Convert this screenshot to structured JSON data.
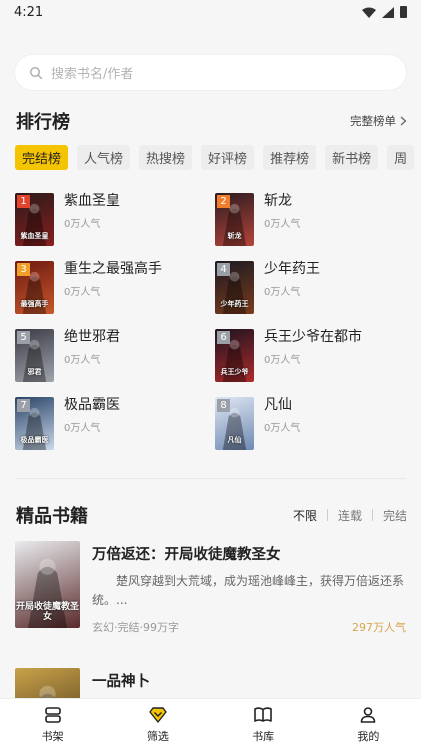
{
  "status": {
    "time": "4:21"
  },
  "search": {
    "placeholder": "搜索书名/作者"
  },
  "ranking": {
    "title": "排行榜",
    "more_label": "完整榜单",
    "tabs": [
      "完结榜",
      "人气榜",
      "热搜榜",
      "好评榜",
      "推荐榜",
      "新书榜",
      "周"
    ],
    "active_tab": 0,
    "items": [
      {
        "rank": "1",
        "title": "紫血圣皇",
        "hot": "0万人气",
        "badge_color": "#e3422c",
        "cover": [
          "#2a1a1a",
          "#8a1f1f"
        ],
        "cover_text": "紫血圣皇"
      },
      {
        "rank": "2",
        "title": "斩龙",
        "hot": "0万人气",
        "badge_color": "#ef7d2b",
        "cover": [
          "#2b1b20",
          "#b5453a"
        ],
        "cover_text": "斩龙"
      },
      {
        "rank": "3",
        "title": "重生之最强高手",
        "hot": "0万人气",
        "badge_color": "#f0a028",
        "cover": [
          "#6e1a12",
          "#c8572b"
        ],
        "cover_text": "最强高手"
      },
      {
        "rank": "4",
        "title": "少年药王",
        "hot": "0万人气",
        "badge_color": "#9ba0a8",
        "cover": [
          "#1a1a22",
          "#7c3b1c"
        ],
        "cover_text": "少年药王"
      },
      {
        "rank": "5",
        "title": "绝世邪君",
        "hot": "0万人气",
        "badge_color": "#9ba0a8",
        "cover": [
          "#3a3a44",
          "#a0a5ad"
        ],
        "cover_text": "邪君"
      },
      {
        "rank": "6",
        "title": "兵王少爷在都市",
        "hot": "0万人气",
        "badge_color": "#9ba0a8",
        "cover": [
          "#1c1420",
          "#b02a2a"
        ],
        "cover_text": "兵王少爷"
      },
      {
        "rank": "7",
        "title": "极品霸医",
        "hot": "0万人气",
        "badge_color": "#9ba0a8",
        "cover": [
          "#2a4466",
          "#c9d7ea"
        ],
        "cover_text": "极品霸医"
      },
      {
        "rank": "8",
        "title": "凡仙",
        "hot": "0万人气",
        "badge_color": "#9ba0a8",
        "cover": [
          "#dfe6f2",
          "#6f8ab4"
        ],
        "cover_text": "凡仙"
      }
    ]
  },
  "featured": {
    "title": "精品书籍",
    "filters": [
      "不限",
      "连载",
      "完结"
    ],
    "active_filter": 0,
    "books": [
      {
        "title": "万倍返还：开局收徒魔教圣女",
        "desc": "楚风穿越到大荒域，成为瑶池峰峰主，获得万倍返还系统。...",
        "meta": "玄幻·完结·99万字",
        "hot": "297万人气",
        "cover": [
          "#e9ecef",
          "#5a2a2a"
        ],
        "cover_text": "开局收徒魔教圣女"
      },
      {
        "title": "一品神卜",
        "desc": "",
        "meta": "",
        "hot": "",
        "cover": [
          "#c9a24a",
          "#3a2a12"
        ],
        "cover_text": ""
      }
    ]
  },
  "bottom_nav": [
    {
      "label": "书架",
      "icon": "bookshelf-icon"
    },
    {
      "label": "筛选",
      "icon": "filter-diamond-icon"
    },
    {
      "label": "书库",
      "icon": "book-library-icon"
    },
    {
      "label": "我的",
      "icon": "profile-icon"
    }
  ],
  "colors": {
    "accent": "#f5c400",
    "hot": "#d7a54d"
  }
}
